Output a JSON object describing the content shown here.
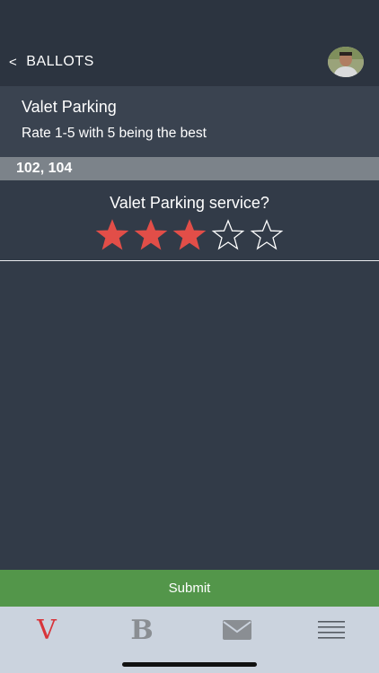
{
  "header": {
    "back_chevron": "<",
    "back_label": "BALLOTS"
  },
  "ballot": {
    "title": "Valet Parking",
    "subtitle": "Rate 1-5 with 5 being the best"
  },
  "section": {
    "label": "102, 104"
  },
  "question": {
    "text": "Valet Parking service?",
    "rating": 3,
    "max_rating": 5
  },
  "submit": {
    "label": "Submit"
  },
  "tabbar": {
    "items": [
      {
        "label": "V",
        "icon": "v-logo-icon",
        "active": true
      },
      {
        "label": "B",
        "icon": "b-logo-icon",
        "active": false
      },
      {
        "label": "",
        "icon": "mail-icon",
        "active": false
      },
      {
        "label": "",
        "icon": "menu-icon",
        "active": false
      }
    ]
  },
  "colors": {
    "star_filled": "#e24e48",
    "star_empty_stroke": "#ffffff",
    "submit_bg": "#53964a",
    "background": "#323b48"
  }
}
